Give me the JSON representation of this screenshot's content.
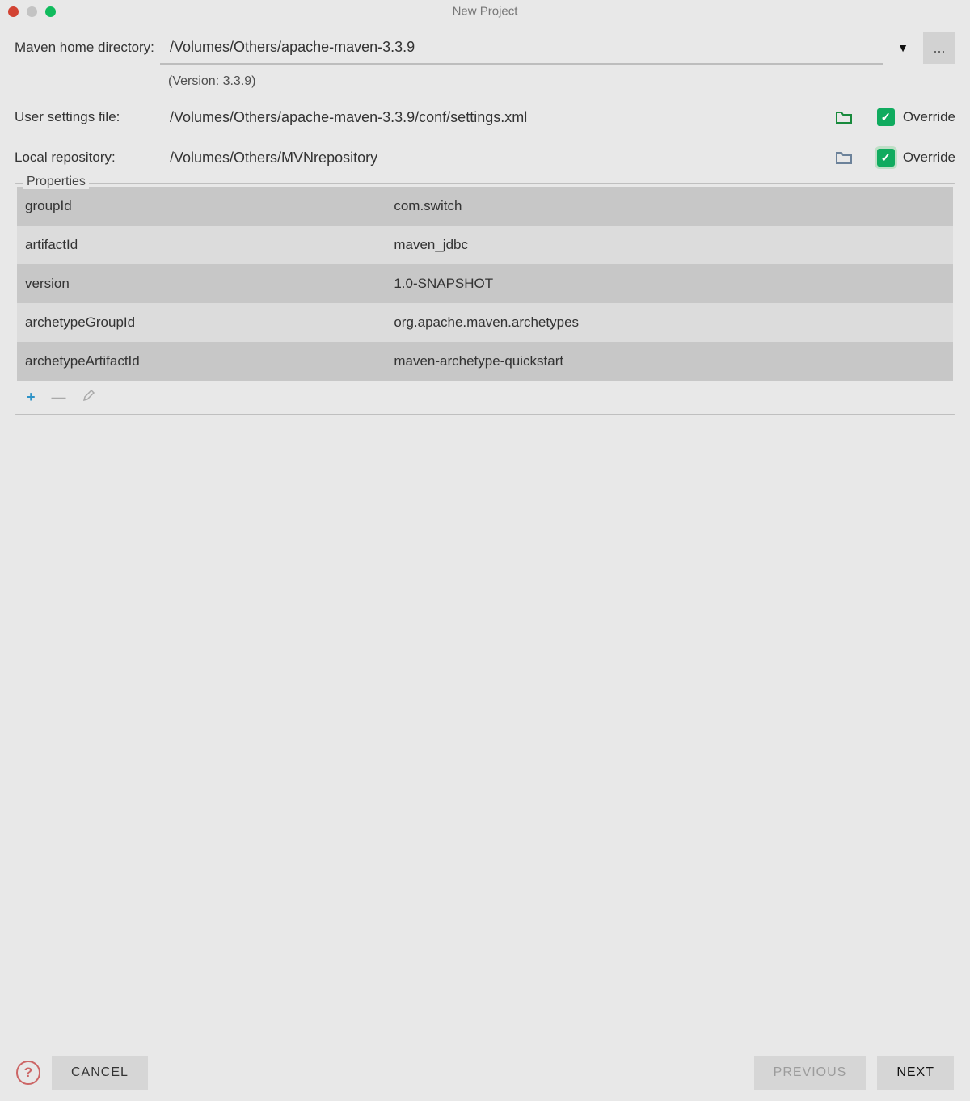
{
  "window": {
    "title": "New Project"
  },
  "fields": {
    "mavenHome": {
      "label": "Maven home directory:",
      "value": "/Volumes/Others/apache-maven-3.3.9",
      "versionHint": "(Version: 3.3.9)",
      "browse": "..."
    },
    "settings": {
      "label": "User settings file:",
      "value": "/Volumes/Others/apache-maven-3.3.9/conf/settings.xml",
      "overrideLabel": "Override"
    },
    "localRepo": {
      "label": "Local repository:",
      "value": "/Volumes/Others/MVNrepository",
      "overrideLabel": "Override"
    }
  },
  "properties": {
    "title": "Properties",
    "rows": [
      {
        "key": "groupId",
        "value": "com.switch"
      },
      {
        "key": "artifactId",
        "value": "maven_jdbc"
      },
      {
        "key": "version",
        "value": "1.0-SNAPSHOT"
      },
      {
        "key": "archetypeGroupId",
        "value": "org.apache.maven.archetypes"
      },
      {
        "key": "archetypeArtifactId",
        "value": "maven-archetype-quickstart"
      }
    ]
  },
  "footer": {
    "help": "?",
    "cancel": "CANCEL",
    "previous": "PREVIOUS",
    "next": "NEXT"
  }
}
